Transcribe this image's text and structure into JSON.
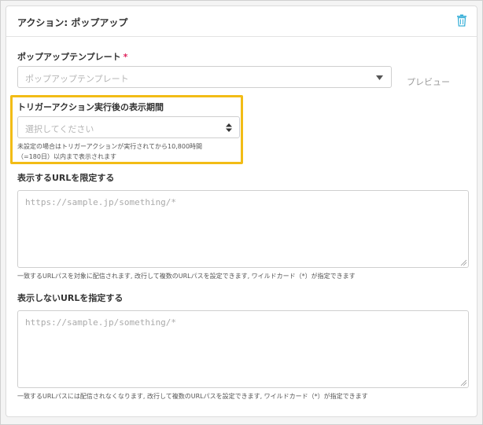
{
  "panel": {
    "title": "アクション: ポップアップ",
    "delete_icon": "trash-icon"
  },
  "template_field": {
    "label": "ポップアップテンプレート",
    "required_mark": "*",
    "placeholder": "ポップアップテンプレート",
    "caret_icon": "caret-down-icon",
    "preview_label": "プレビュー"
  },
  "duration_field": {
    "label": "トリガーアクション実行後の表示期間",
    "placeholder": "選択してください",
    "updown_icon": "sort-updown-icon",
    "help_line1": "未設定の場合はトリガーアクションが実行されてから10,800時間",
    "help_line2": "（=180日）以内まで表示されます",
    "highlight_color": "#f2bc16"
  },
  "include_urls": {
    "label": "表示するURLを限定する",
    "placeholder": "https://sample.jp/something/*",
    "help": "一致するURLパスを対象に配信されます, 改行して複数のURLパスを設定できます, ワイルドカード（*）が指定できます"
  },
  "exclude_urls": {
    "label": "表示しないURLを指定する",
    "placeholder": "https://sample.jp/something/*",
    "help": "一致するURLパスには配信されなくなります, 改行して複数のURLパスを設定できます, ワイルドカード（*）が指定できます"
  },
  "colors": {
    "accent": "#3ab0d8",
    "required": "#e0245e"
  }
}
